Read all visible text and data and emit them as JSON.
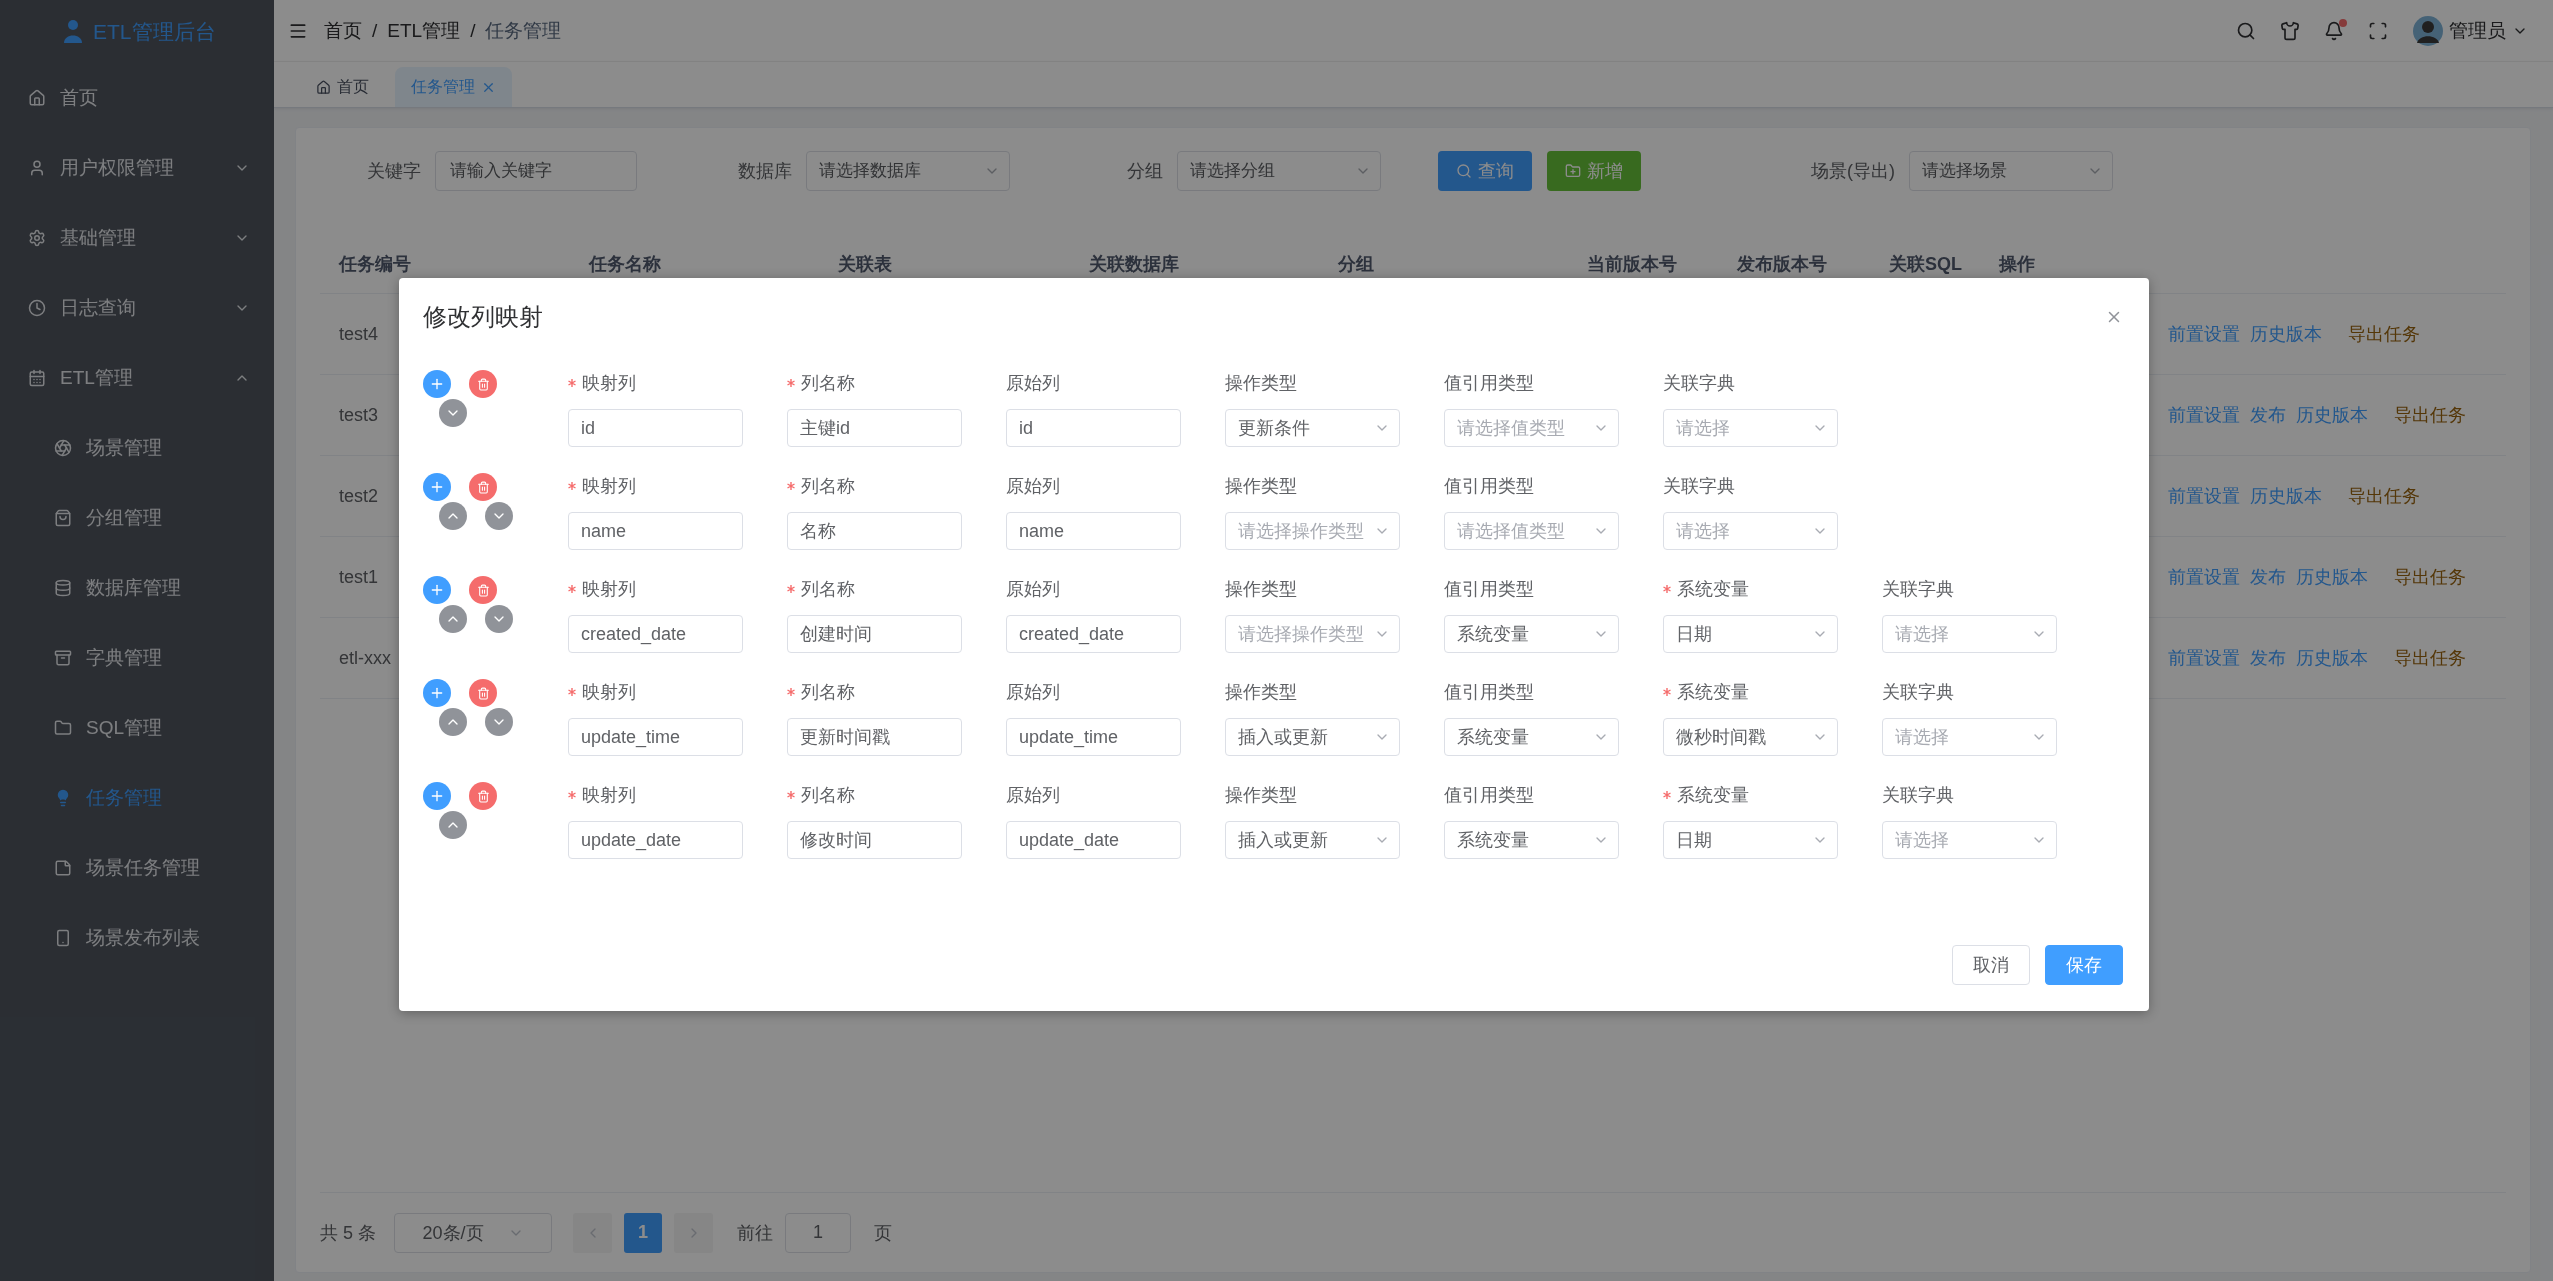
{
  "app": {
    "title": "ETL管理后台"
  },
  "sidebar": {
    "items": [
      {
        "label": "首页",
        "kind": "link",
        "selected": false
      },
      {
        "label": "用户权限管理",
        "kind": "group",
        "selected": false,
        "expanded": false
      },
      {
        "label": "基础管理",
        "kind": "group",
        "selected": false,
        "expanded": false
      },
      {
        "label": "日志查询",
        "kind": "group",
        "selected": false,
        "expanded": false
      },
      {
        "label": "ETL管理",
        "kind": "group",
        "selected": false,
        "expanded": true,
        "children": [
          {
            "label": "场景管理",
            "selected": false
          },
          {
            "label": "分组管理",
            "selected": false
          },
          {
            "label": "数据库管理",
            "selected": false
          },
          {
            "label": "字典管理",
            "selected": false
          },
          {
            "label": "SQL管理",
            "selected": false
          },
          {
            "label": "任务管理",
            "selected": true
          },
          {
            "label": "场景任务管理",
            "selected": false
          },
          {
            "label": "场景发布列表",
            "selected": false
          }
        ]
      }
    ]
  },
  "header": {
    "breadcrumb": [
      "首页",
      "ETL管理",
      "任务管理"
    ],
    "separator": "/",
    "notification_dot": true,
    "user": "管理员"
  },
  "tabs": [
    {
      "label": "首页",
      "selected": false
    },
    {
      "label": "任务管理",
      "selected": true
    }
  ],
  "filters": {
    "keyword": {
      "label": "关键字",
      "placeholder": "请输入关键字"
    },
    "database": {
      "label": "数据库",
      "placeholder": "请选择数据库"
    },
    "group": {
      "label": "分组",
      "placeholder": "请选择分组"
    },
    "buttons": [
      {
        "label": "查询",
        "kind": "primary"
      },
      {
        "label": "新增",
        "kind": "success"
      }
    ],
    "scene": {
      "label": "场景(导出)",
      "placeholder": "请选择场景"
    }
  },
  "table": {
    "columns": [
      "任务编号",
      "任务名称",
      "关联表",
      "关联数据库",
      "分组",
      "当前版本号",
      "发布版本号",
      "关联SQL",
      "操作"
    ],
    "rows": [
      {
        "task_id": "test4",
        "actions": [
          {
            "label": "前置设置",
            "kind": "primary"
          },
          {
            "label": "历史版本",
            "kind": "primary"
          },
          {
            "label": "导出任务",
            "kind": "warning"
          }
        ]
      },
      {
        "task_id": "test3",
        "actions": [
          {
            "label": "前置设置",
            "kind": "primary"
          },
          {
            "label": "发布",
            "kind": "primary"
          },
          {
            "label": "历史版本",
            "kind": "primary"
          },
          {
            "label": "导出任务",
            "kind": "warning"
          }
        ]
      },
      {
        "task_id": "test2",
        "actions": [
          {
            "label": "前置设置",
            "kind": "primary"
          },
          {
            "label": "历史版本",
            "kind": "primary"
          },
          {
            "label": "导出任务",
            "kind": "warning"
          }
        ]
      },
      {
        "task_id": "test1",
        "actions": [
          {
            "label": "前置设置",
            "kind": "primary"
          },
          {
            "label": "发布",
            "kind": "primary"
          },
          {
            "label": "历史版本",
            "kind": "primary"
          },
          {
            "label": "导出任务",
            "kind": "warning"
          }
        ]
      },
      {
        "task_id": "etl-xxx",
        "actions": [
          {
            "label": "前置设置",
            "kind": "primary"
          },
          {
            "label": "发布",
            "kind": "primary"
          },
          {
            "label": "历史版本",
            "kind": "primary"
          },
          {
            "label": "导出任务",
            "kind": "warning"
          }
        ]
      }
    ]
  },
  "pagination": {
    "total": "共 5 条",
    "page_size": "20条/页",
    "pages": [
      {
        "label": "1",
        "selected": true
      }
    ],
    "goto_label": "前往",
    "goto_value": "1",
    "goto_suffix": "页"
  },
  "modal": {
    "title": "修改列映射",
    "rows": [
      {
        "can_move_up": false,
        "can_move_down": true,
        "fields": [
          {
            "label": "映射列",
            "required": true,
            "kind": "input",
            "value": "id"
          },
          {
            "label": "列名称",
            "required": true,
            "kind": "input",
            "value": "主键id"
          },
          {
            "label": "原始列",
            "required": false,
            "kind": "input",
            "value": "id"
          },
          {
            "label": "操作类型",
            "required": false,
            "kind": "select",
            "value": "更新条件"
          },
          {
            "label": "值引用类型",
            "required": false,
            "kind": "select",
            "placeholder": "请选择值类型"
          },
          {
            "label": "关联字典",
            "required": false,
            "kind": "select",
            "placeholder": "请选择"
          }
        ]
      },
      {
        "can_move_up": true,
        "can_move_down": true,
        "fields": [
          {
            "label": "映射列",
            "required": true,
            "kind": "input",
            "value": "name"
          },
          {
            "label": "列名称",
            "required": true,
            "kind": "input",
            "value": "名称"
          },
          {
            "label": "原始列",
            "required": false,
            "kind": "input",
            "value": "name"
          },
          {
            "label": "操作类型",
            "required": false,
            "kind": "select",
            "placeholder": "请选择操作类型"
          },
          {
            "label": "值引用类型",
            "required": false,
            "kind": "select",
            "placeholder": "请选择值类型"
          },
          {
            "label": "关联字典",
            "required": false,
            "kind": "select",
            "placeholder": "请选择"
          }
        ]
      },
      {
        "can_move_up": true,
        "can_move_down": true,
        "fields": [
          {
            "label": "映射列",
            "required": true,
            "kind": "input",
            "value": "created_date"
          },
          {
            "label": "列名称",
            "required": true,
            "kind": "input",
            "value": "创建时间"
          },
          {
            "label": "原始列",
            "required": false,
            "kind": "input",
            "value": "created_date"
          },
          {
            "label": "操作类型",
            "required": false,
            "kind": "select",
            "placeholder": "请选择操作类型"
          },
          {
            "label": "值引用类型",
            "required": false,
            "kind": "select",
            "value": "系统变量"
          },
          {
            "label": "系统变量",
            "required": true,
            "kind": "select",
            "value": "日期"
          },
          {
            "label": "关联字典",
            "required": false,
            "kind": "select",
            "placeholder": "请选择"
          }
        ]
      },
      {
        "can_move_up": true,
        "can_move_down": true,
        "fields": [
          {
            "label": "映射列",
            "required": true,
            "kind": "input",
            "value": "update_time"
          },
          {
            "label": "列名称",
            "required": true,
            "kind": "input",
            "value": "更新时间戳"
          },
          {
            "label": "原始列",
            "required": false,
            "kind": "input",
            "value": "update_time"
          },
          {
            "label": "操作类型",
            "required": false,
            "kind": "select",
            "value": "插入或更新"
          },
          {
            "label": "值引用类型",
            "required": false,
            "kind": "select",
            "value": "系统变量"
          },
          {
            "label": "系统变量",
            "required": true,
            "kind": "select",
            "value": "微秒时间戳"
          },
          {
            "label": "关联字典",
            "required": false,
            "kind": "select",
            "placeholder": "请选择"
          }
        ]
      },
      {
        "can_move_up": true,
        "can_move_down": false,
        "fields": [
          {
            "label": "映射列",
            "required": true,
            "kind": "input",
            "value": "update_date"
          },
          {
            "label": "列名称",
            "required": true,
            "kind": "input",
            "value": "修改时间"
          },
          {
            "label": "原始列",
            "required": false,
            "kind": "input",
            "value": "update_date"
          },
          {
            "label": "操作类型",
            "required": false,
            "kind": "select",
            "value": "插入或更新"
          },
          {
            "label": "值引用类型",
            "required": false,
            "kind": "select",
            "value": "系统变量"
          },
          {
            "label": "系统变量",
            "required": true,
            "kind": "select",
            "value": "日期"
          },
          {
            "label": "关联字典",
            "required": false,
            "kind": "select",
            "placeholder": "请选择"
          }
        ]
      }
    ],
    "buttons": [
      {
        "label": "取消",
        "kind": "default"
      },
      {
        "label": "保存",
        "kind": "primary"
      }
    ]
  }
}
